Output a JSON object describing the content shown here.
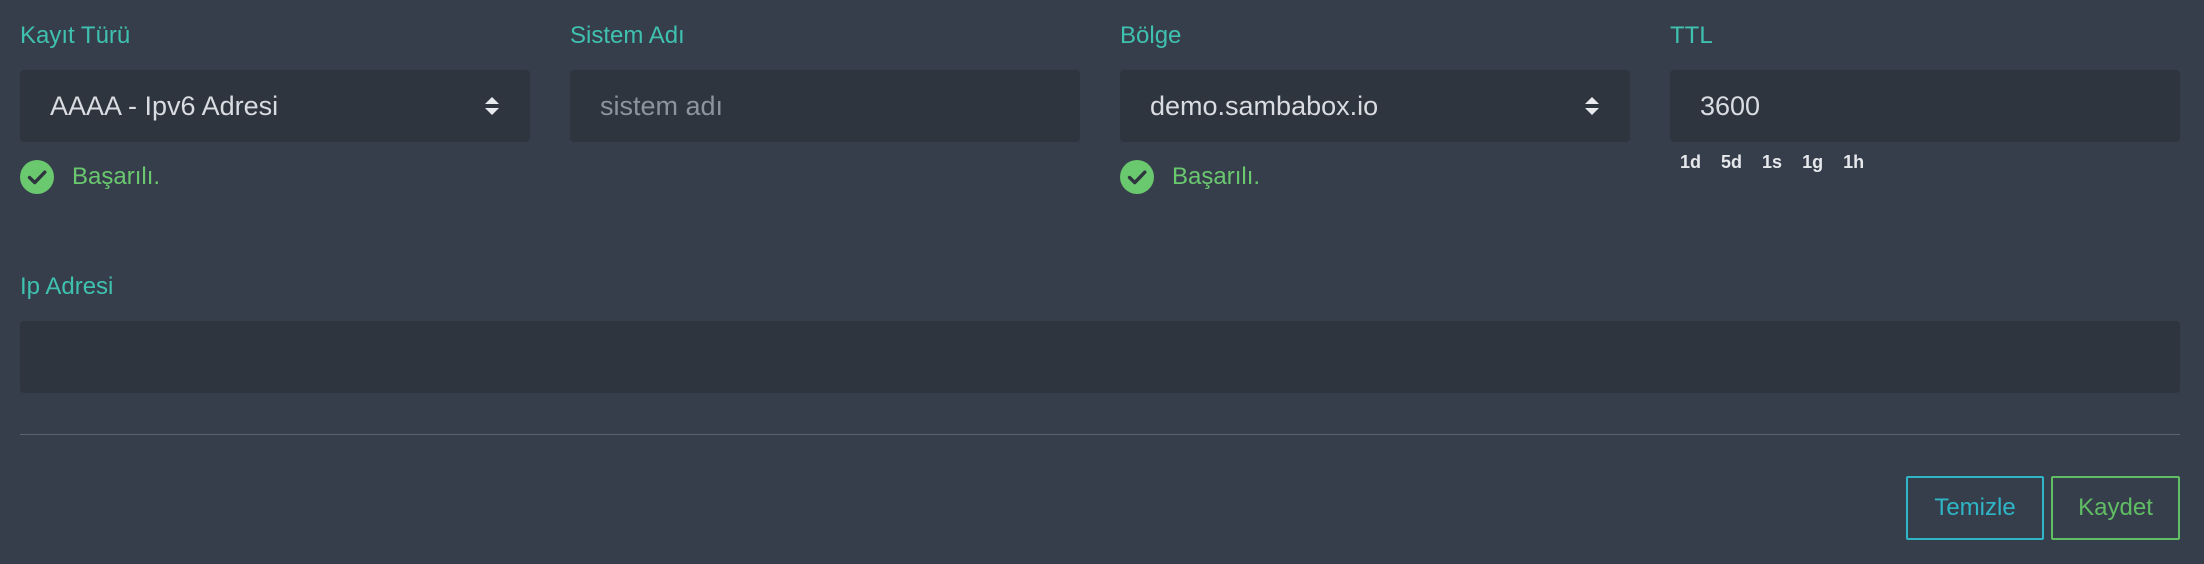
{
  "form": {
    "record_type": {
      "label": "Kayıt Türü",
      "value": "AAAA - Ipv6 Adresi",
      "status": "Başarılı."
    },
    "system_name": {
      "label": "Sistem Adı",
      "value": "",
      "placeholder": "sistem adı"
    },
    "zone": {
      "label": "Bölge",
      "value": "demo.sambabox.io",
      "status": "Başarılı."
    },
    "ttl": {
      "label": "TTL",
      "value": "3600",
      "presets": [
        "1d",
        "5d",
        "1s",
        "1g",
        "1h"
      ]
    },
    "ip_address": {
      "label": "Ip Adresi",
      "value": "",
      "placeholder": ""
    }
  },
  "actions": {
    "clear_label": "Temizle",
    "save_label": "Kaydet"
  },
  "icons": {
    "status": "check-circle-icon",
    "select": "sort-arrows-icon"
  },
  "colors": {
    "background": "#373e4b",
    "field_bg": "#2f353f",
    "label": "#3fc1b0",
    "success": "#6ac86f",
    "clear_button": "#2fb6c6",
    "save_button": "#5fbd64"
  }
}
